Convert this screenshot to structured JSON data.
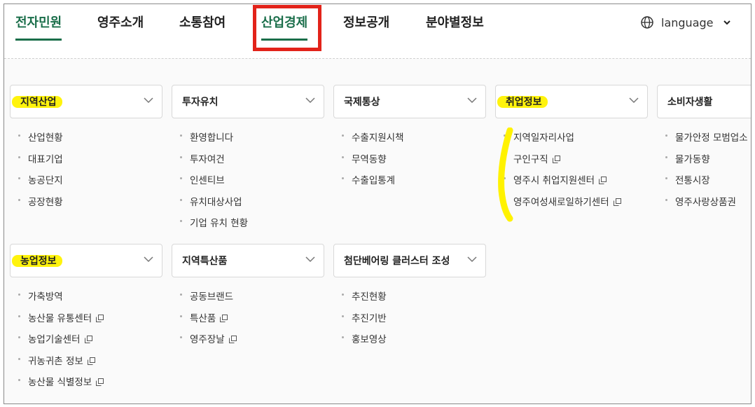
{
  "top_nav": {
    "items": [
      "전자민원",
      "영주소개",
      "소통참여",
      "산업경제",
      "정보공개",
      "분야별정보"
    ],
    "active": "산업경제",
    "language_label": "language",
    "accent_color": "#1a6e4a",
    "highlight_box_color": "#e2231a"
  },
  "categories": [
    {
      "title": "지역산업",
      "highlighted": true,
      "items": [
        {
          "label": "산업현황",
          "external": false
        },
        {
          "label": "대표기업",
          "external": false
        },
        {
          "label": "농공단지",
          "external": false
        },
        {
          "label": "공장현황",
          "external": false
        }
      ]
    },
    {
      "title": "투자유치",
      "highlighted": false,
      "items": [
        {
          "label": "환영합니다",
          "external": false
        },
        {
          "label": "투자여건",
          "external": false
        },
        {
          "label": "인센티브",
          "external": false
        },
        {
          "label": "유치대상사업",
          "external": false
        },
        {
          "label": "기업 유치 현황",
          "external": false
        }
      ]
    },
    {
      "title": "국제통상",
      "highlighted": false,
      "items": [
        {
          "label": "수출지원시책",
          "external": false
        },
        {
          "label": "무역동향",
          "external": false
        },
        {
          "label": "수출입통계",
          "external": false
        }
      ]
    },
    {
      "title": "취업정보",
      "highlighted": true,
      "items": [
        {
          "label": "지역일자리사업",
          "external": false
        },
        {
          "label": "구인구직",
          "external": true
        },
        {
          "label": "영주시 취업지원센터",
          "external": true
        },
        {
          "label": "영주여성새로일하기센터",
          "external": true
        }
      ]
    },
    {
      "title": "소비자생활",
      "highlighted": false,
      "items": [
        {
          "label": "물가안정 모범업소",
          "external": false
        },
        {
          "label": "물가동향",
          "external": false
        },
        {
          "label": "전통시장",
          "external": false
        },
        {
          "label": "영주사랑상품권",
          "external": false
        }
      ]
    },
    {
      "title": "농업정보",
      "highlighted": true,
      "items": [
        {
          "label": "가축방역",
          "external": false
        },
        {
          "label": "농산물 유통센터",
          "external": true
        },
        {
          "label": "농업기술센터",
          "external": true
        },
        {
          "label": "귀농귀촌 정보",
          "external": true
        },
        {
          "label": "농산물 식별정보",
          "external": true
        }
      ]
    },
    {
      "title": "지역특산품",
      "highlighted": false,
      "items": [
        {
          "label": "공동브랜드",
          "external": false
        },
        {
          "label": "특산품",
          "external": true
        },
        {
          "label": "영주장날",
          "external": true
        }
      ]
    },
    {
      "title": "첨단베어링 클러스터 조성",
      "highlighted": false,
      "items": [
        {
          "label": "추진현황",
          "external": false
        },
        {
          "label": "추진기반",
          "external": false
        },
        {
          "label": "홍보영상",
          "external": false
        }
      ]
    }
  ],
  "highlight_color": "#fff200",
  "icons": {
    "globe": "globe-icon",
    "chevron": "chevron-down-icon",
    "external": "external-link-icon"
  }
}
